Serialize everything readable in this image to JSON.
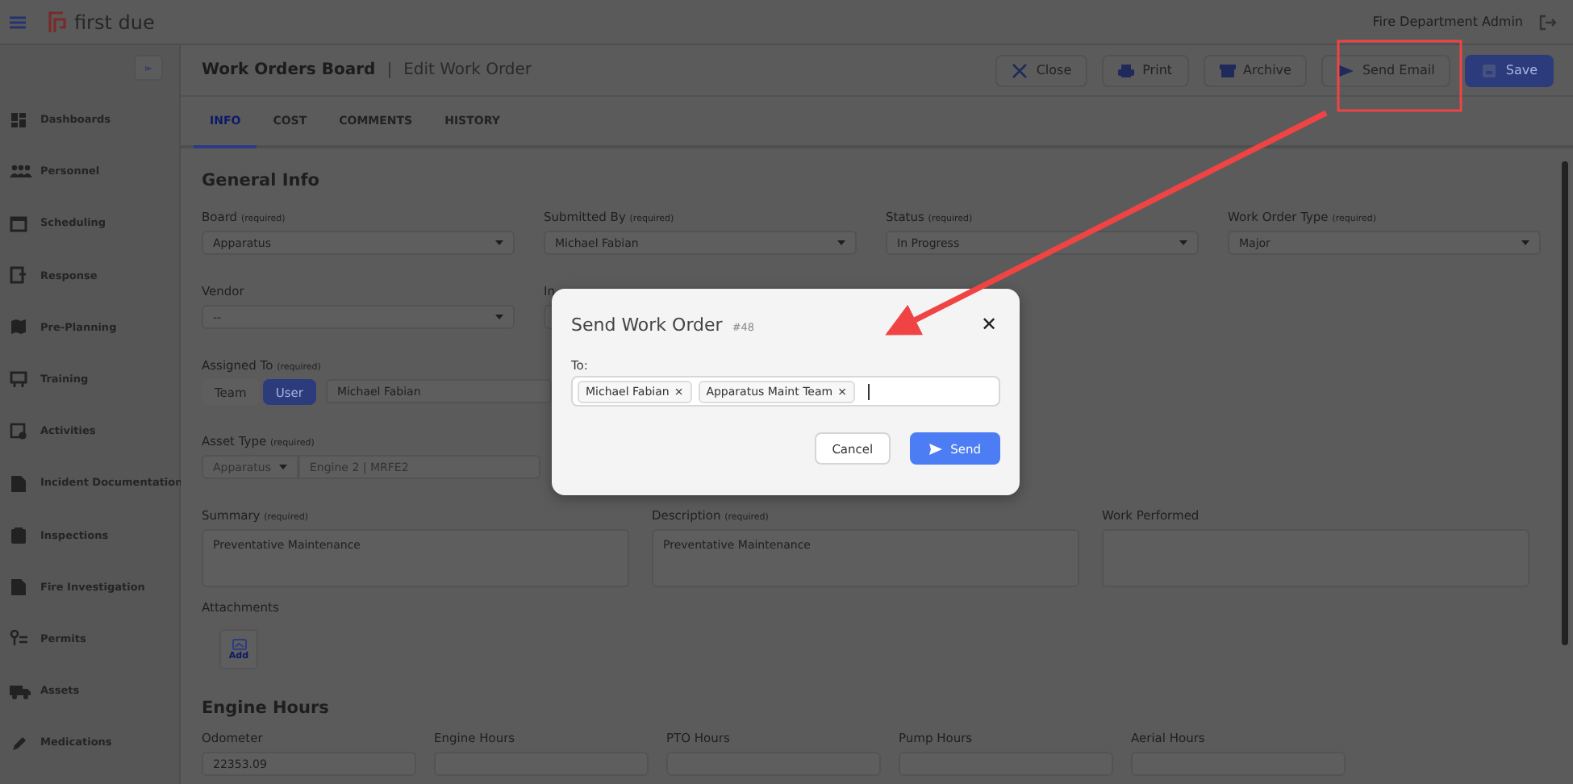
{
  "top_bar": {
    "brand": "first due",
    "user": "Fire Department Admin"
  },
  "sidebar": {
    "items": [
      {
        "label": "Dashboards"
      },
      {
        "label": "Personnel"
      },
      {
        "label": "Scheduling"
      },
      {
        "label": "Response"
      },
      {
        "label": "Pre-Planning"
      },
      {
        "label": "Training"
      },
      {
        "label": "Activities"
      },
      {
        "label": "Incident Documentation"
      },
      {
        "label": "Inspections"
      },
      {
        "label": "Fire Investigation"
      },
      {
        "label": "Permits"
      },
      {
        "label": "Assets"
      },
      {
        "label": "Medications"
      }
    ]
  },
  "header": {
    "breadcrumb": "Work Orders Board",
    "separator": "|",
    "title": "Edit Work Order",
    "buttons": [
      {
        "label": "Close",
        "kind": "default"
      },
      {
        "label": "Print",
        "kind": "default"
      },
      {
        "label": "Archive",
        "kind": "default"
      },
      {
        "label": "Send Email",
        "kind": "default"
      },
      {
        "label": "Save",
        "kind": "primary"
      }
    ]
  },
  "tabs": [
    {
      "label": "INFO",
      "selected": true
    },
    {
      "label": "COST",
      "selected": false
    },
    {
      "label": "COMMENTS",
      "selected": false
    },
    {
      "label": "HISTORY",
      "selected": false
    }
  ],
  "general_info": {
    "title": "General Info",
    "row_1": [
      {
        "label": "Board",
        "note": "(required)",
        "value": "Apparatus"
      },
      {
        "label": "Submitted By",
        "note": "(required)",
        "value": "Michael Fabian"
      },
      {
        "label": "Status",
        "note": "(required)",
        "value": "In Progress"
      },
      {
        "label": "Work Order Type",
        "note": "(required)",
        "value": "Major"
      }
    ],
    "row_2": [
      {
        "label": "Vendor",
        "value": "--"
      },
      {
        "label": "In"
      }
    ],
    "assigned_to": {
      "label": "Assigned To",
      "note": "(required)",
      "options": [
        {
          "label": "Team",
          "selected": false
        },
        {
          "label": "User",
          "selected": true
        }
      ],
      "value": "Michael Fabian"
    },
    "asset_type": {
      "label": "Asset Type",
      "note": "(required)",
      "type_value": "Apparatus",
      "asset_value": "Engine 2 | MRFE2"
    },
    "text_areas": [
      {
        "label": "Summary",
        "note": "(required)",
        "value": "Preventative Maintenance"
      },
      {
        "label": "Description",
        "note": "(required)",
        "value": "Preventative Maintenance"
      },
      {
        "label": "Work Performed"
      }
    ],
    "attachments": {
      "label": "Attachments",
      "add_label": "Add"
    }
  },
  "engine_hours": {
    "title": "Engine Hours",
    "fields": [
      {
        "label": "Odometer",
        "value": "22353.09"
      },
      {
        "label": "Engine Hours"
      },
      {
        "label": "PTO Hours"
      },
      {
        "label": "Pump Hours"
      },
      {
        "label": "Aerial Hours"
      }
    ]
  },
  "dialog": {
    "title": "Send Work Order",
    "number": "#48",
    "close": "✕",
    "to_label": "To:",
    "recipients": [
      {
        "name": "Michael Fabian",
        "remove": "×"
      },
      {
        "name": "Apparatus Maint Team",
        "remove": "×"
      }
    ],
    "buttons": [
      {
        "label": "Cancel",
        "kind": "default"
      },
      {
        "label": "Send",
        "kind": "primary"
      }
    ]
  }
}
